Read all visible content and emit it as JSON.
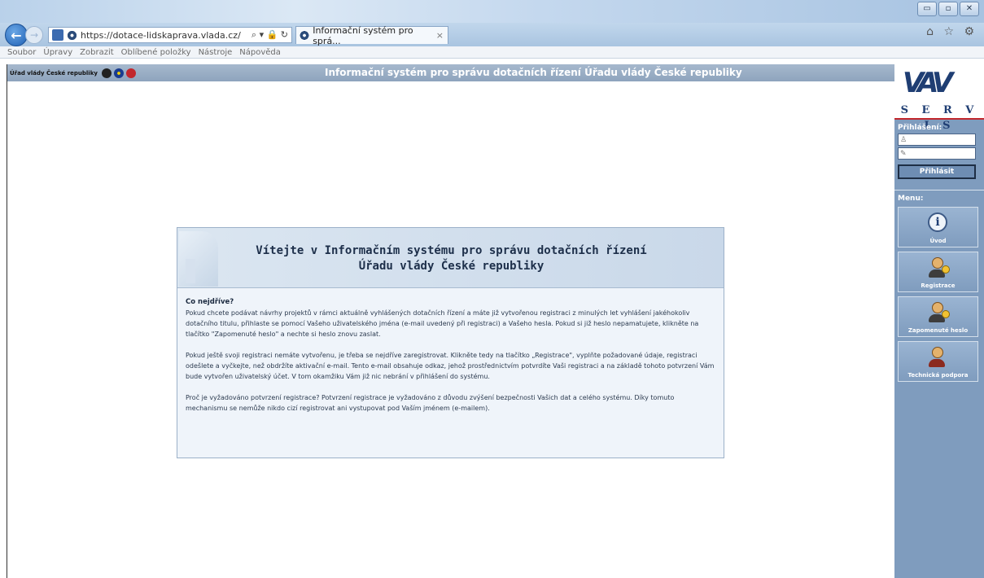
{
  "browser": {
    "url_prefix": "https://",
    "url_domain": "dotace-lidskaprava.vlada.cz/",
    "url_tools": "⌕ ▾ 🔒 ↻",
    "tab_title": "Informační systém pro sprá...",
    "tab_close": "×",
    "window_buttons": [
      "▭",
      "▫",
      "✕"
    ],
    "toolbar_icons": "⌂ ☆ ⚙",
    "menu": [
      "Soubor",
      "Úpravy",
      "Zobrazit",
      "Oblíbené položky",
      "Nástroje",
      "Nápověda"
    ]
  },
  "header": {
    "org": "Úřad vlády České republiky",
    "title": "Informační systém pro správu dotačních řízení Úřadu vlády České republiky"
  },
  "sidebar": {
    "logo": "VAV",
    "logo_sub": "S E R V I S",
    "login_label": "Přihlášení:",
    "username_icon": "♙",
    "password_icon": "✎",
    "login_button": "Přihlásit",
    "menu_label": "Menu:",
    "menu_items": [
      {
        "label": "Úvod",
        "icon": "info-icon"
      },
      {
        "label": "Registrace",
        "icon": "user-key-icon"
      },
      {
        "label": "Zapomenuté heslo",
        "icon": "user-key-icon"
      },
      {
        "label": "Technická podpora",
        "icon": "user-support-icon"
      }
    ]
  },
  "welcome": {
    "title_line1": "Vítejte v Informačním systému pro správu dotačních řízení",
    "title_line2": "Úřadu vlády České republiky",
    "heading": "Co nejdříve?",
    "p1": "Pokud chcete podávat návrhy projektů v rámci aktuálně vyhlášených dotačních řízení a máte již vytvořenou registraci z minulých let vyhlášení jakéhokoliv dotačního titulu, přihlaste se pomocí Vašeho uživatelského jména (e-mail uvedený při registraci) a Vašeho hesla. Pokud si již heslo nepamatujete, klikněte na tlačítko \"Zapomenuté heslo\" a nechte si heslo znovu zaslat.",
    "p2": "Pokud ještě svoji registraci nemáte vytvořenu, je třeba se nejdříve zaregistrovat. Klikněte tedy na tlačítko „Registrace\", vyplňte požadované údaje, registraci odešlete a vyčkejte, než obdržíte aktivační e-mail. Tento e-mail obsahuje odkaz, jehož prostřednictvím potvrdíte Vaši registraci a na základě tohoto potvrzení Vám bude vytvořen uživatelský účet. V tom okamžiku Vám již nic nebrání v přihlášení do systému.",
    "p3": "Proč je vyžadováno potvrzení registrace? Potvrzení registrace je vyžadováno z důvodu zvýšení bezpečnosti Vašich dat a celého systému. Díky tomuto mechanismu se nemůže nikdo cizí registrovat ani vystupovat pod Vaším jménem (e-mailem)."
  }
}
